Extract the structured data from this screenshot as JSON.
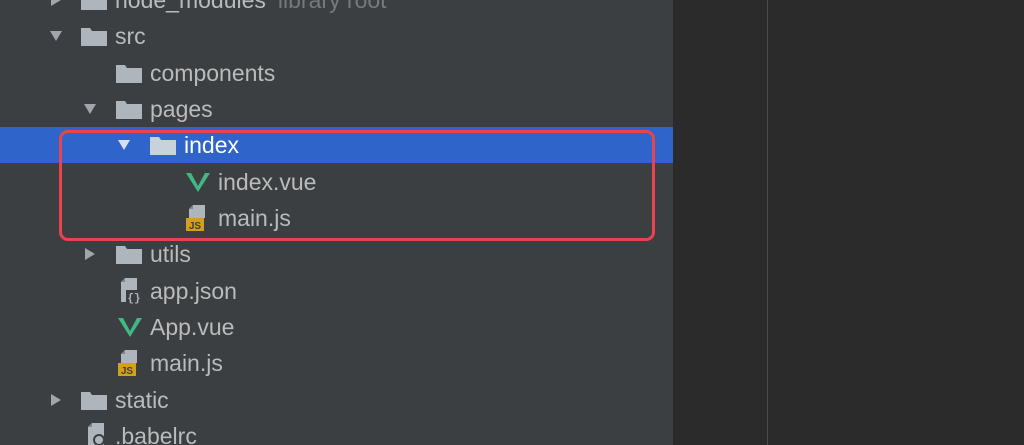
{
  "tree": {
    "rows": [
      {
        "label": "node_modules",
        "suffix": "library root",
        "expanded": false,
        "icon": "folder-icon"
      },
      {
        "label": "src",
        "expanded": true,
        "icon": "folder-icon"
      },
      {
        "label": "components",
        "icon": "folder-icon"
      },
      {
        "label": "pages",
        "expanded": true,
        "icon": "folder-icon"
      },
      {
        "label": "index",
        "expanded": true,
        "icon": "folder-icon",
        "selected": true
      },
      {
        "label": "index.vue",
        "icon": "vue-file-icon"
      },
      {
        "label": "main.js",
        "icon": "js-file-icon",
        "badge": "JS"
      },
      {
        "label": "utils",
        "expanded": false,
        "icon": "folder-icon"
      },
      {
        "label": "app.json",
        "icon": "json-file-icon",
        "badge": "{}"
      },
      {
        "label": "App.vue",
        "icon": "vue-file-icon"
      },
      {
        "label": "main.js",
        "icon": "js-file-icon",
        "badge": "JS"
      },
      {
        "label": "static",
        "expanded": false,
        "icon": "folder-icon"
      },
      {
        "label": ".babelrc",
        "icon": "config-file-icon"
      }
    ]
  },
  "colors": {
    "panel_bg": "#3c3f41",
    "selection": "#2f65ca",
    "text": "#bbbbbb",
    "folder": "#aeb5bd",
    "vue": "#41b883",
    "js_badge": "#d4a017",
    "highlight_border": "#e9434d"
  }
}
